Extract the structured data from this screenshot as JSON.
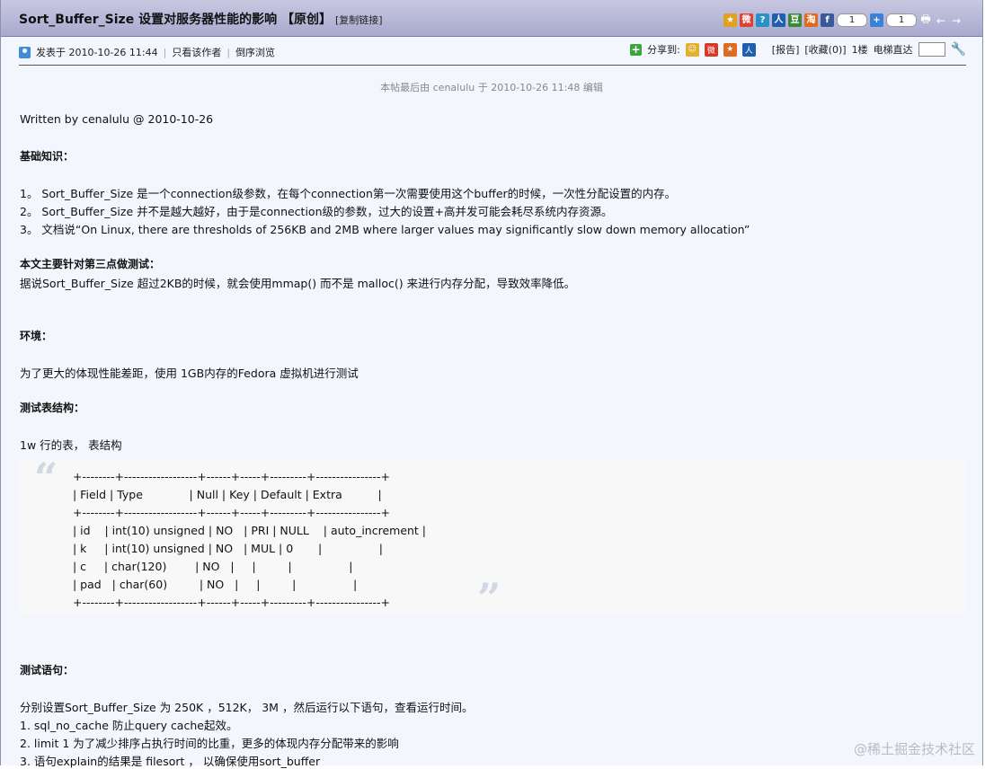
{
  "header": {
    "title": "Sort_Buffer_Size 设置对服务器性能的影响 【原创】",
    "copy_link": "[复制链接]",
    "counters": [
      "1",
      "1"
    ]
  },
  "meta": {
    "posted": "发表于 2010-10-26 11:44",
    "only_author": "只看该作者",
    "reverse": "倒序浏览",
    "share_label": "分享到:",
    "report": "[报告]",
    "favorite": "[收藏(0)]",
    "floor": "1楼",
    "jump": "电梯直达"
  },
  "edit_note": "本帖最后由 cenalulu 于 2010-10-26 11:48 编辑",
  "post": {
    "byline": "Written by cenalulu @ 2010-10-26",
    "h_basics": "基础知识：",
    "basic_1": "1。 Sort_Buffer_Size 是一个connection级参数，在每个connection第一次需要使用这个buffer的时候，一次性分配设置的内存。",
    "basic_2": "2。 Sort_Buffer_Size 并不是越大越好，由于是connection级的参数，过大的设置+高并发可能会耗尽系统内存资源。",
    "basic_3": "3。 文档说“On Linux, there are thresholds of 256KB and 2MB where larger values may significantly slow down memory allocation”",
    "h_focus": "本文主要针对第三点做测试：",
    "focus_text": "据说Sort_Buffer_Size 超过2KB的时候，就会使用mmap() 而不是 malloc() 来进行内存分配，导致效率降低。",
    "h_env": "环境：",
    "env_text": "为了更大的体现性能差距，使用 1GB内存的Fedora 虚拟机进行测试",
    "h_table": "测试表结构：",
    "table_intro": "1w 行的表， 表结构",
    "h_stmt": "测试语句：",
    "stmt_intro": "分别设置Sort_Buffer_Size 为 250K ，512K， 3M ，然后运行以下语句，查看运行时间。",
    "stmt_1": "1. sql_no_cache 防止query cache起效。",
    "stmt_2": "2. limit 1 为了减少排序占执行时间的比重，更多的体现内存分配带来的影响",
    "stmt_3": "3. 语句explain的结果是 filesort ， 以确保使用sort_buffer"
  },
  "quote_lines": [
    "+--------+------------------+------+-----+---------+----------------+",
    "| Field | Type             | Null | Key | Default | Extra          |",
    "+--------+------------------+------+-----+---------+----------------+",
    "| id    | int(10) unsigned | NO   | PRI | NULL    | auto_increment |",
    "| k     | int(10) unsigned | NO   | MUL | 0       |                |",
    "| c     | char(120)        | NO   |     |         |                |",
    "| pad   | char(60)         | NO   |     |         |                |",
    "+--------+------------------+------+-----+---------+----------------+"
  ],
  "watermark": "@稀土掘金技术社区"
}
